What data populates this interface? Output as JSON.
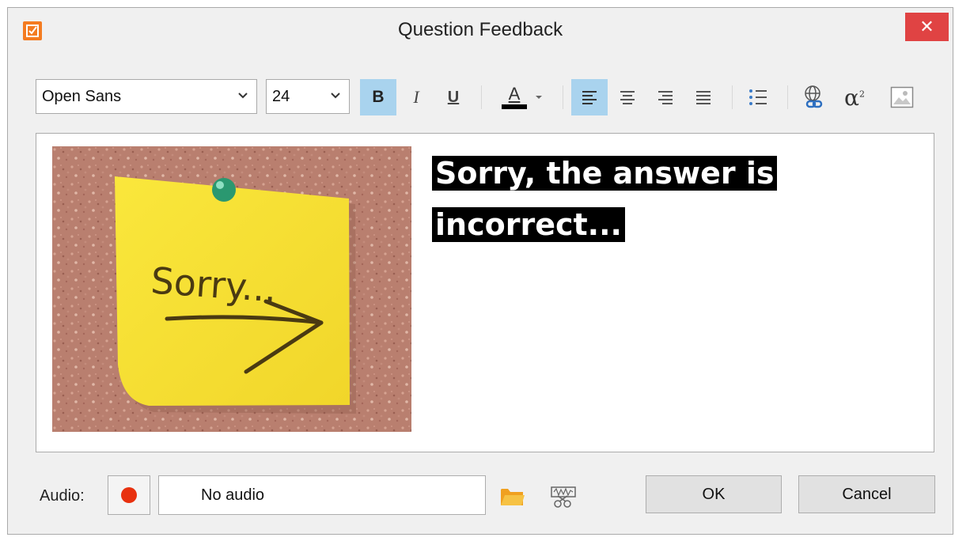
{
  "window": {
    "title": "Question Feedback",
    "close_symbol": "✕",
    "accent_color": "#f47b20",
    "close_color": "#e04343"
  },
  "toolbar": {
    "font_family": "Open Sans",
    "font_size": "24",
    "bold_label": "B",
    "italic_label": "I",
    "underline_label": "U",
    "text_color_label": "A",
    "active_color": "#a9d3ee",
    "icons": [
      "bold-icon",
      "italic-icon",
      "underline-icon",
      "font-color-icon",
      "align-left-icon",
      "align-center-icon",
      "align-right-icon",
      "align-justify-icon",
      "bullet-list-icon",
      "hyperlink-icon",
      "equation-icon",
      "image-icon"
    ]
  },
  "editor": {
    "image_text": "Sorry...",
    "feedback_text": "Sorry, the answer is incorrect..."
  },
  "audio": {
    "label": "Audio:",
    "status": "No audio"
  },
  "buttons": {
    "ok": "OK",
    "cancel": "Cancel"
  }
}
